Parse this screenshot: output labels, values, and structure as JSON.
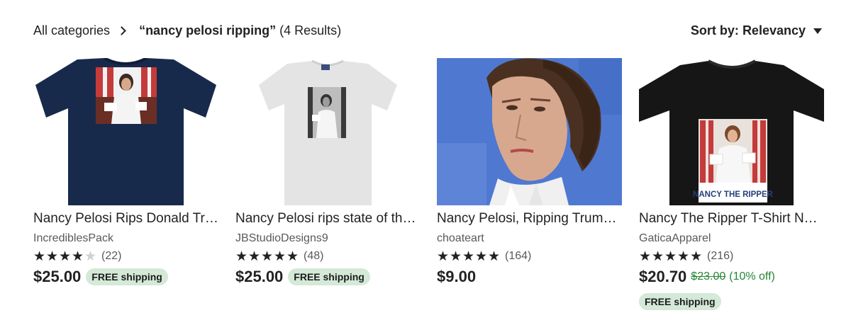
{
  "breadcrumb": {
    "root_label": "All categories",
    "query": "“nancy pelosi ripping”",
    "results_count": "(4 Results)"
  },
  "sort": {
    "label": "Sort by:",
    "value": "Relevancy"
  },
  "listings": [
    {
      "title": "Nancy Pelosi Rips Donald Trump's State of the Union Speech T-Shirt",
      "shop": "IncrediblesPack",
      "rating": 4,
      "reviews": "(22)",
      "price": "$25.00",
      "free_shipping": "FREE shipping",
      "image": "navy-tshirt-pelosi-print"
    },
    {
      "title": "Nancy Pelosi rips state of the union speech T-Shirt",
      "shop": "JBStudioDesigns9",
      "rating": 5,
      "reviews": "(48)",
      "price": "$25.00",
      "free_shipping": "FREE shipping",
      "image": "white-tshirt-pelosi-print"
    },
    {
      "title": "Nancy Pelosi, Ripping Trump's Speech painting",
      "shop": "choateart",
      "rating": 5,
      "reviews": "(164)",
      "price": "$9.00",
      "image": "pelosi-portrait-painting"
    },
    {
      "title": "Nancy The Ripper T-Shirt Nancy Pelosi",
      "shop": "GaticaApparel",
      "rating": 5,
      "reviews": "(216)",
      "price": "$20.70",
      "original_price": "$23.00",
      "discount": "(10% off)",
      "free_shipping": "FREE shipping",
      "image": "black-tshirt-nancy-the-ripper",
      "shirt_text": "NANCY THE RIPPER"
    }
  ],
  "colors": {
    "text": "#222222",
    "muted": "#595959",
    "sale_green": "#258635",
    "badge_bg": "#d4e9d7",
    "navy_shirt": "#182a4c",
    "painting_blue": "#4f78d1"
  }
}
